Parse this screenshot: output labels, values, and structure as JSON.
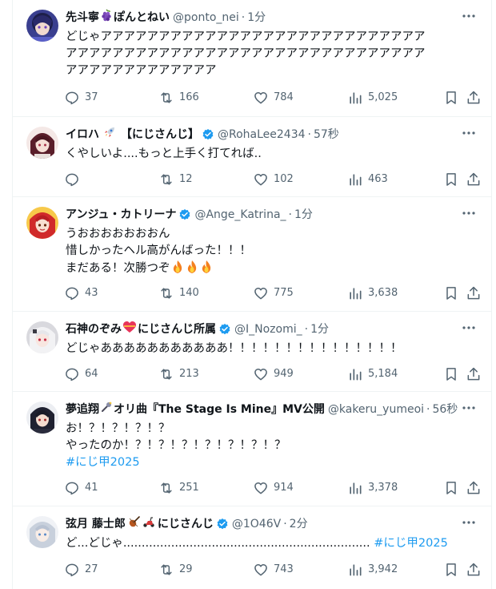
{
  "tweets": [
    {
      "name": "先斗寧",
      "name_suffix": "ぽんとねい",
      "handle": "@ponto_nei",
      "time": "1分",
      "lines": [
        "どじゃアアアアアアアアアアアアアアアアアアアアアアアアアアアア",
        "アアアアアアアアアアアアアアアアアアアアアアアアアアアアアアア",
        "アアアアアアアアアアアアア"
      ],
      "replies": "37",
      "reposts": "166",
      "likes": "784",
      "views": "5,025"
    },
    {
      "name": "イロハ",
      "name_suffix": "【にじさんじ】",
      "handle": "@RohaLee2434",
      "time": "57秒",
      "lines": [
        "くやしいよ....もっと上手く打てれば.."
      ],
      "replies": "",
      "reposts": "12",
      "likes": "102",
      "views": "463"
    },
    {
      "name": "アンジュ・カトリーナ",
      "handle": "@Ange_Katrina_",
      "time": "1分",
      "lines": [
        "うおおおおおおおん",
        "惜しかったヘル高がんばった！！！",
        "まだある！次勝つぞ"
      ],
      "replies": "43",
      "reposts": "140",
      "likes": "775",
      "views": "3,638"
    },
    {
      "name": "石神のぞみ",
      "name_suffix": "にじさんじ所属",
      "handle": "@I_Nozomi_",
      "time": "1分",
      "lines": [
        "どじゃあああああああああああ！！！！！！！！！！！！！！！"
      ],
      "replies": "64",
      "reposts": "213",
      "likes": "949",
      "views": "5,184"
    },
    {
      "name": "夢追翔",
      "name_suffix": "オリ曲『The Stage Is Mine』MV公開",
      "handle": "@kakeru_yumeoi",
      "time": "56秒",
      "lines": [
        "お！？！？！？！？",
        "やったのか！？！？！？！？！？！？！？"
      ],
      "hashtag": "#にじ甲2025",
      "replies": "41",
      "reposts": "251",
      "likes": "914",
      "views": "3,378"
    },
    {
      "name": "弦月 藤士郎",
      "name_suffix": "にじさんじ",
      "handle": "@1O46V",
      "time": "2分",
      "lines": [
        "ど...どじゃ..................................................................."
      ],
      "hashtag": "#にじ甲2025",
      "replies": "27",
      "reposts": "29",
      "likes": "743",
      "views": "3,942"
    }
  ],
  "colors": {
    "text": "#0f1419",
    "secondary": "#536471",
    "link": "#1d9bf0",
    "divider": "#eff3f4"
  },
  "icons": [
    "reply-icon",
    "repost-icon",
    "like-icon",
    "views-icon",
    "bookmark-icon",
    "share-icon",
    "more-icon",
    "verified-badge-icon"
  ]
}
